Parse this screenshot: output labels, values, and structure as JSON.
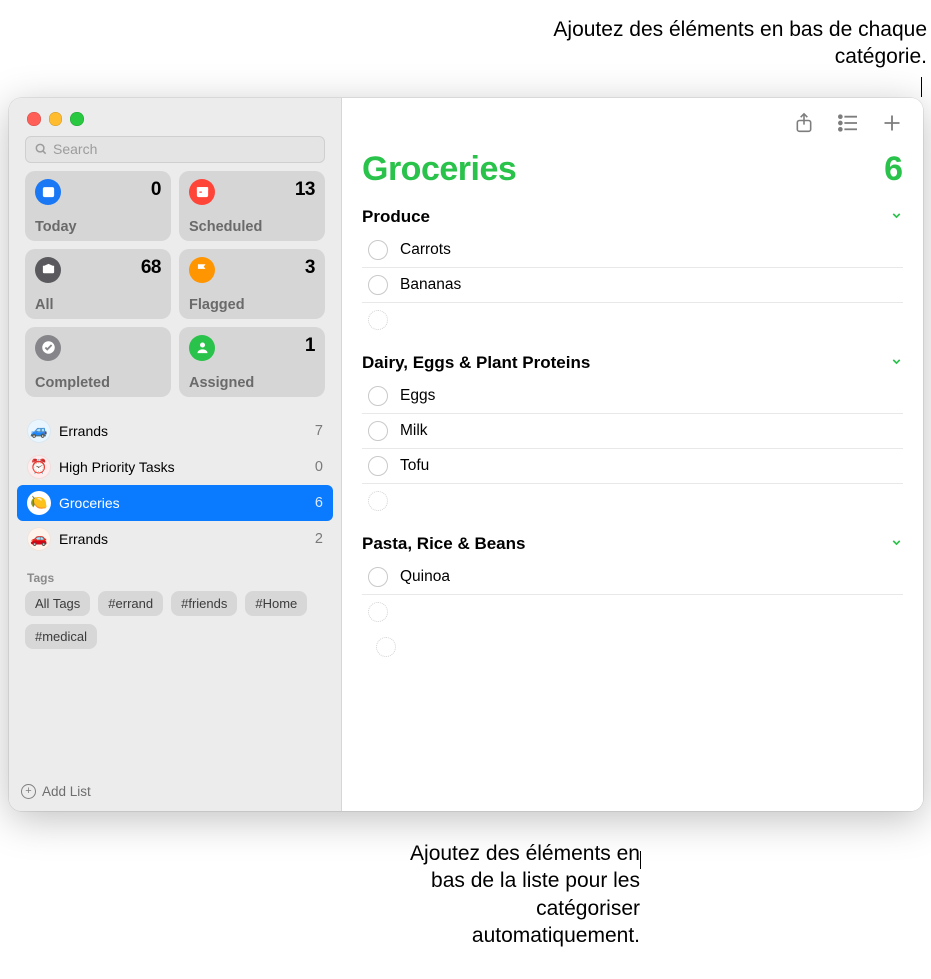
{
  "callouts": {
    "top": "Ajoutez des éléments en bas de chaque catégorie.",
    "bottom": "Ajoutez des éléments en bas de la liste pour les catégoriser automatiquement."
  },
  "search": {
    "placeholder": "Search"
  },
  "smartLists": [
    {
      "key": "today",
      "label": "Today",
      "count": "0",
      "bg": "#1b78f5"
    },
    {
      "key": "scheduled",
      "label": "Scheduled",
      "count": "13",
      "bg": "#ff4438"
    },
    {
      "key": "all",
      "label": "All",
      "count": "68",
      "bg": "#5a5a5e"
    },
    {
      "key": "flagged",
      "label": "Flagged",
      "count": "3",
      "bg": "#ff9500"
    },
    {
      "key": "completed",
      "label": "Completed",
      "count": "",
      "bg": "#86868a"
    },
    {
      "key": "assigned",
      "label": "Assigned",
      "count": "1",
      "bg": "#29c24a"
    }
  ],
  "userLists": [
    {
      "name": "Errands",
      "count": "7",
      "emoji": "🚙",
      "bg": "#e9f6ff",
      "selected": false
    },
    {
      "name": "High Priority Tasks",
      "count": "0",
      "emoji": "⏰",
      "bg": "#ffecec",
      "selected": false
    },
    {
      "name": "Groceries",
      "count": "6",
      "emoji": "🍋",
      "bg": "#ffffff",
      "selected": true
    },
    {
      "name": "Errands",
      "count": "2",
      "emoji": "🚗",
      "bg": "#fff4ec",
      "selected": false
    }
  ],
  "tagsTitle": "Tags",
  "tags": [
    "All Tags",
    "#errand",
    "#friends",
    "#Home",
    "#medical"
  ],
  "addList": "Add List",
  "mainList": {
    "title": "Groceries",
    "count": "6",
    "sections": [
      {
        "title": "Produce",
        "items": [
          "Carrots",
          "Bananas"
        ]
      },
      {
        "title": "Dairy, Eggs & Plant Proteins",
        "items": [
          "Eggs",
          "Milk",
          "Tofu"
        ]
      },
      {
        "title": "Pasta, Rice & Beans",
        "items": [
          "Quinoa"
        ]
      }
    ]
  }
}
